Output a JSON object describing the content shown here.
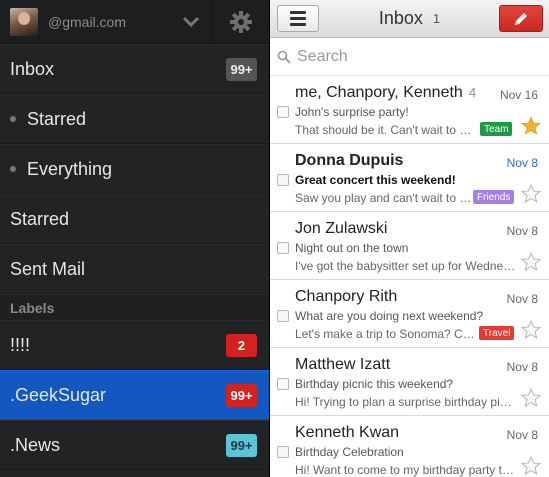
{
  "drawer": {
    "account_email": "@gmail.com",
    "items": [
      {
        "label": "Inbox",
        "badge": "99+"
      },
      {
        "label": "Starred"
      },
      {
        "label": "Everything"
      },
      {
        "label": "Starred"
      },
      {
        "label": "Sent Mail"
      }
    ],
    "labels_heading": "Labels",
    "labels": [
      {
        "label": "!!!!",
        "badge": "2",
        "badge_color": "#d32222"
      },
      {
        "label": ".GeekSugar",
        "badge": "99+",
        "badge_color": "#d32222",
        "selected": true
      },
      {
        "label": ".News",
        "badge": "99+",
        "badge_color": "#5cc4d6"
      }
    ]
  },
  "inbox": {
    "title": "Inbox",
    "count": "1",
    "search_placeholder": "Search",
    "messages": [
      {
        "from": "me, Chanpory, Kenneth",
        "thread_count": "4",
        "date": "Nov 16",
        "subject": "John's surprise party!",
        "snippet": "That should be it. Can't wait to see...",
        "tag": "Team",
        "tag_color": "#1c9a4a",
        "starred": true,
        "unread": false
      },
      {
        "from": "Donna Dupuis",
        "date": "Nov 8",
        "subject": "Great concert this weekend!",
        "snippet": "Saw you play and can't wait to see...",
        "tag": "Friends",
        "tag_color": "#a57ee8",
        "starred": false,
        "unread": true
      },
      {
        "from": "Jon Zulawski",
        "date": "Nov 8",
        "subject": "Night out on the town",
        "snippet": "I've got the babysitter set up for Wednesd...",
        "starred": false,
        "unread": false
      },
      {
        "from": "Chanpory Rith",
        "date": "Nov 8",
        "subject": "What are you doing next weekend?",
        "snippet": "Let's make a trip to Sonoma? Call ...",
        "tag": "Travel",
        "tag_color": "#e8382f",
        "starred": false,
        "unread": false
      },
      {
        "from": "Matthew Izatt",
        "date": "Nov 8",
        "subject": "Birthday picnic this weekend?",
        "snippet": "Hi! Trying to plan a surprise birthday picnic...",
        "starred": false,
        "unread": false
      },
      {
        "from": "Kenneth Kwan",
        "date": "Nov 8",
        "subject": "Birthday Celebration",
        "snippet": "Hi! Want to come to my birthday party this ...",
        "starred": false,
        "unread": false
      }
    ]
  }
}
